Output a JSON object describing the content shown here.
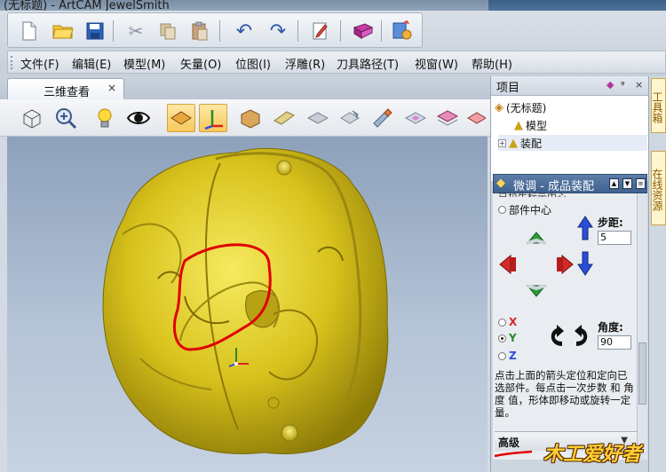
{
  "window": {
    "title": "(无标题) - ArtCAM JewelSmith"
  },
  "menu": [
    "文件(F)",
    "编辑(E)",
    "模型(M)",
    "矢量(O)",
    "位图(I)",
    "浮雕(R)",
    "刀具路径(T)",
    "视窗(W)",
    "帮助(H)"
  ],
  "doc_tab": {
    "label": "三维查看",
    "close": "×"
  },
  "project": {
    "title": "项目",
    "ctrl_pin": "ᵠ",
    "ctrl_close": "×",
    "root": "(无标题)",
    "model": "模型",
    "assembly": "装配"
  },
  "tweak": {
    "title": "微调 - 成品装配",
    "cut_text": "已拉生标示中心",
    "part_center": "部件中心",
    "step_label": "步距:",
    "step_value": "5",
    "axes": [
      "X",
      "Y",
      "Z"
    ],
    "selected_axis": "Y",
    "angle_label": "角度:",
    "angle_value": "90",
    "instructions": "点击上面的箭头定位和定向已选部件。每点击一次步数 和 角度 值，形体即移动或旋转一定量。",
    "advanced": "高级",
    "advanced_arrow": "▼"
  },
  "side_tabs": [
    "工具箱",
    "在线资源"
  ],
  "watermark": "木工爱好者",
  "colors": {
    "gold": "#d4c21a",
    "annotation_red": "#e00000",
    "panel_head": "#3f628f"
  }
}
